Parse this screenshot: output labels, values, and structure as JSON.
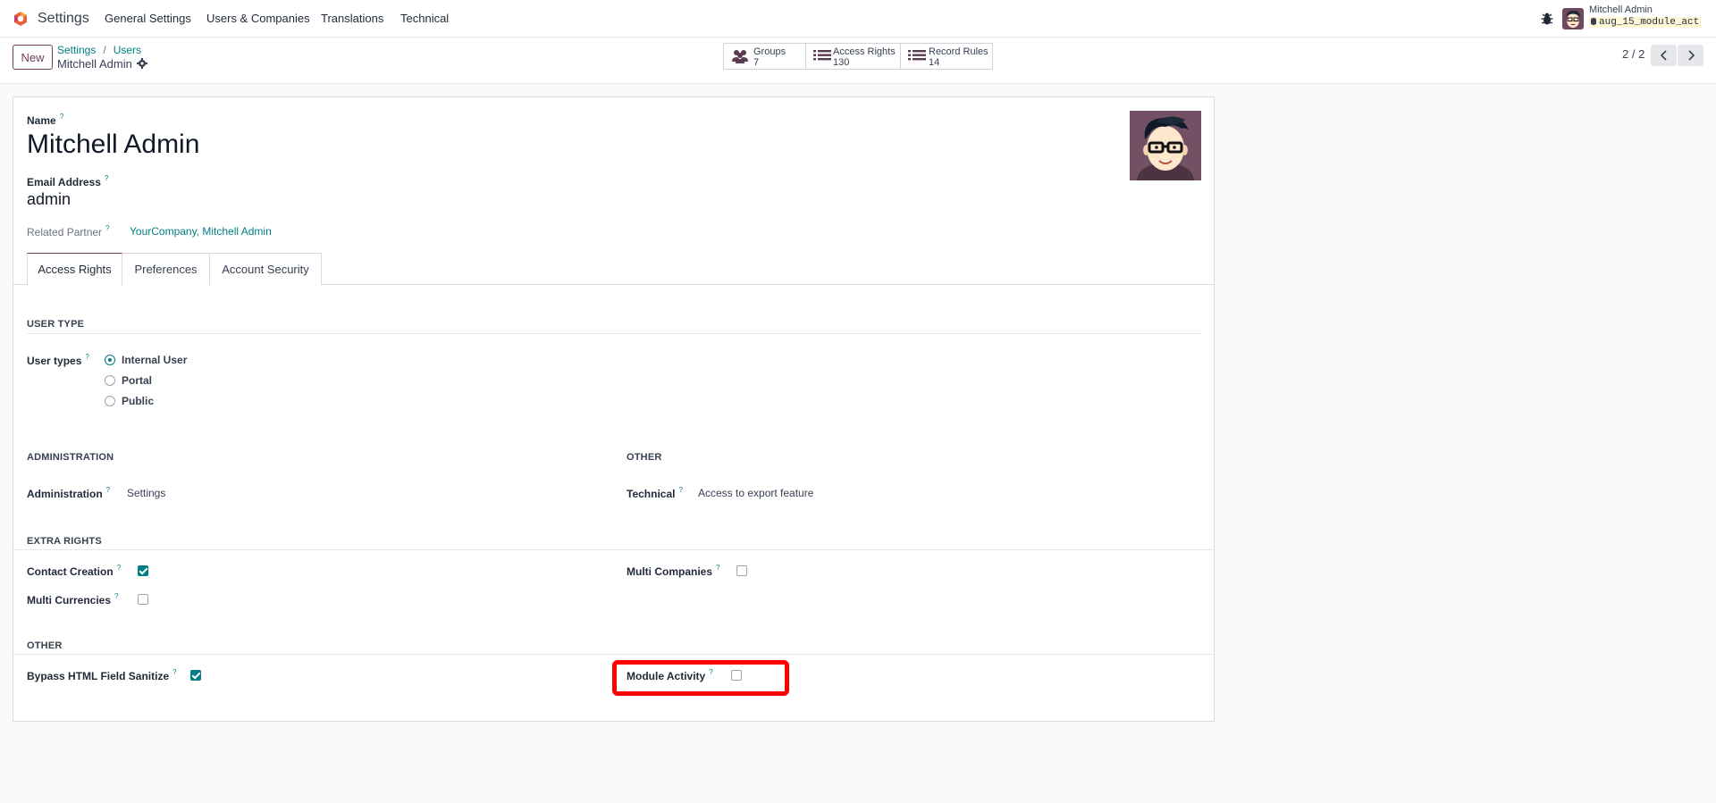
{
  "navbar": {
    "app_name": "Settings",
    "menu": [
      "General Settings",
      "Users & Companies",
      "Translations",
      "Technical"
    ],
    "user_name": "Mitchell Admin",
    "database": "aug_15_module_act"
  },
  "control_panel": {
    "new_label": "New",
    "breadcrumb": [
      "Settings",
      "Users"
    ],
    "current_record": "Mitchell Admin",
    "smart_buttons": [
      {
        "title": "Groups",
        "value": "7",
        "icon": "users-icon"
      },
      {
        "title": "Access Rights",
        "value": "130",
        "icon": "list-icon"
      },
      {
        "title": "Record Rules",
        "value": "14",
        "icon": "list-icon"
      }
    ],
    "pager": "2 / 2"
  },
  "form": {
    "name_label": "Name",
    "name_value": "Mitchell Admin",
    "email_label": "Email Address",
    "email_value": "admin",
    "related_partner_label": "Related Partner",
    "related_partner_value": "YourCompany, Mitchell Admin",
    "tooltip_mark": "?",
    "tabs": [
      "Access Rights",
      "Preferences",
      "Account Security"
    ],
    "active_tab": "Access Rights",
    "user_type": {
      "section": "USER TYPE",
      "label": "User types",
      "options": [
        "Internal User",
        "Portal",
        "Public"
      ],
      "selected": "Internal User"
    },
    "administration": {
      "section": "ADMINISTRATION",
      "label": "Administration",
      "value": "Settings"
    },
    "other_top": {
      "section": "OTHER",
      "label": "Technical",
      "value": "Access to export feature"
    },
    "extra_rights": {
      "section": "EXTRA RIGHTS",
      "contact_creation": {
        "label": "Contact Creation",
        "checked": true
      },
      "multi_currencies": {
        "label": "Multi Currencies",
        "checked": false
      },
      "multi_companies": {
        "label": "Multi Companies",
        "checked": false
      }
    },
    "other_bottom": {
      "section": "OTHER",
      "bypass_html": {
        "label": "Bypass HTML Field Sanitize",
        "checked": true
      },
      "module_activity": {
        "label": "Module Activity",
        "checked": false
      }
    }
  },
  "colors": {
    "brand": "#71405e",
    "accent": "#017e84",
    "highlight": "#ff0000"
  }
}
